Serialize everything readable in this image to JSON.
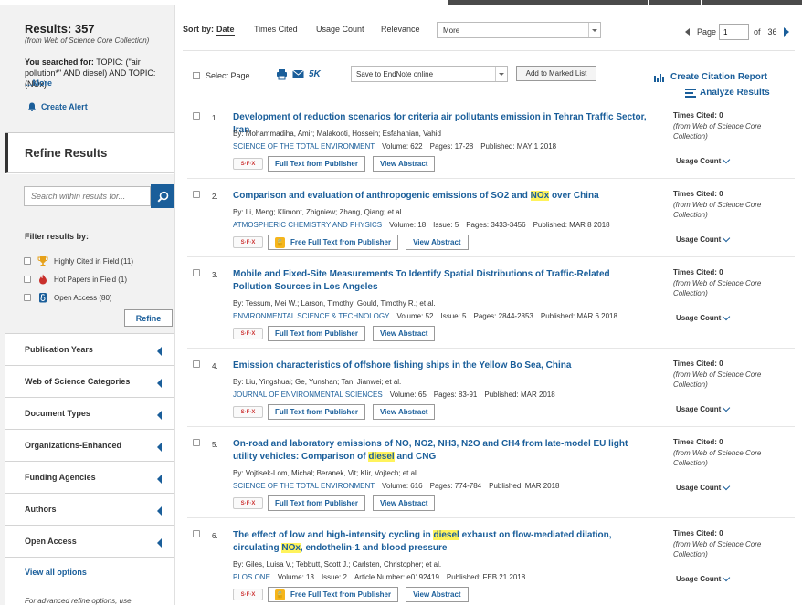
{
  "results": {
    "count_label": "Results: 357",
    "source": "(from Web of Science Core Collection)"
  },
  "search": {
    "label": "You searched for:",
    "query": "TOPIC: (\"air pollution*\" AND diesel) AND TOPIC: (NOx)",
    "more": "...More"
  },
  "alert": {
    "label": "Create Alert"
  },
  "refine": {
    "title": "Refine Results",
    "search_placeholder": "Search within results for...",
    "filter_title": "Filter results by:",
    "filters": [
      {
        "label": "Highly Cited in Field (11)",
        "icon": "trophy-icon"
      },
      {
        "label": "Hot Papers in Field (1)",
        "icon": "flame-icon"
      },
      {
        "label": "Open Access (80)",
        "icon": "open-access-icon"
      }
    ],
    "refine_button": "Refine",
    "categories": [
      "Publication Years",
      "Web of Science Categories",
      "Document Types",
      "Organizations-Enhanced",
      "Funding Agencies",
      "Authors",
      "Open Access"
    ],
    "view_all": "View all options",
    "advanced_note": "For advanced refine options, use"
  },
  "sort": {
    "label": "Sort by:",
    "options": [
      "Date",
      "Times Cited",
      "Usage Count",
      "Relevance"
    ],
    "more_value": "More"
  },
  "pager": {
    "label": "Page",
    "current": "1",
    "of_label": "of",
    "total": "36"
  },
  "toolbar": {
    "select_page": "Select Page",
    "five_k": "5K",
    "save_value": "Save to EndNote online",
    "add_marked": "Add to Marked List",
    "citation_report": "Create Citation Report",
    "analyze": "Analyze Results"
  },
  "labels": {
    "times_cited": "Times Cited: 0",
    "cited_source": "(from Web of Science Core Collection)",
    "usage_count": "Usage Count",
    "full_text": "Full Text from Publisher",
    "free_full_text": "Free Full Text from Publisher",
    "view_abstract": "View Abstract",
    "sfx": "S·F·X"
  },
  "records": [
    {
      "num": "1.",
      "title": "Development of reduction scenarios for criteria air pollutants emission in Tehran Traffic Sector, Iran",
      "authors": "By: Mohammadiha, Amir; Malakooti, Hossein; Esfahanian, Vahid",
      "journal": "SCIENCE OF THE TOTAL ENVIRONMENT",
      "volume": "Volume: 622",
      "issue": "",
      "pages": "Pages: 17-28",
      "published": "Published: MAY 1 2018",
      "free": false
    },
    {
      "num": "2.",
      "title_parts": [
        "Comparison and evaluation of anthropogenic emissions of SO2 and ",
        "NOx",
        " over China"
      ],
      "authors": "By: Li, Meng; Klimont, Zbigniew; Zhang, Qiang; et al.",
      "journal": "ATMOSPHERIC CHEMISTRY AND PHYSICS",
      "volume": "Volume: 18",
      "issue": "Issue: 5",
      "pages": "Pages: 3433-3456",
      "published": "Published: MAR 8 2018",
      "free": true
    },
    {
      "num": "3.",
      "title": "Mobile and Fixed-Site Measurements To Identify Spatial Distributions of Traffic-Related Pollution Sources in Los Angeles",
      "authors": "By: Tessum, Mei W.; Larson, Timothy; Gould, Timothy R.; et al.",
      "journal": "ENVIRONMENTAL SCIENCE & TECHNOLOGY",
      "volume": "Volume: 52",
      "issue": "Issue: 5",
      "pages": "Pages: 2844-2853",
      "published": "Published: MAR 6 2018",
      "free": false
    },
    {
      "num": "4.",
      "title": "Emission characteristics of offshore fishing ships in the Yellow Bo Sea, China",
      "authors": "By: Liu, Yingshuai; Ge, Yunshan; Tan, Jianwei; et al.",
      "journal": "JOURNAL OF ENVIRONMENTAL SCIENCES",
      "volume": "Volume: 65",
      "issue": "",
      "pages": "Pages: 83-91",
      "published": "Published: MAR 2018",
      "free": false
    },
    {
      "num": "5.",
      "title_parts": [
        "On-road and laboratory emissions of NO, NO2, NH3, N2O and CH4 from late-model EU light utility vehicles: Comparison of ",
        "diesel",
        " and CNG"
      ],
      "authors": "By: Vojtisek-Lom, Michal; Beranek, Vit; Klir, Vojtech; et al.",
      "journal": "SCIENCE OF THE TOTAL ENVIRONMENT",
      "volume": "Volume: 616",
      "issue": "",
      "pages": "Pages: 774-784",
      "published": "Published: MAR 2018",
      "free": false
    },
    {
      "num": "6.",
      "title_parts": [
        "The effect of low and high-intensity cycling in ",
        "diesel",
        " exhaust on flow-mediated dilation, circulating ",
        "NOx",
        ", endothelin-1 and blood pressure"
      ],
      "authors": "By: Giles, Luisa V.; Tebbutt, Scott J.; Carlsten, Christopher; et al.",
      "journal": "PLOS ONE",
      "volume": "Volume: 13",
      "issue": "Issue: 2",
      "pages": "Article Number: e0192419",
      "published": "Published: FEB 21 2018",
      "free": true
    }
  ],
  "colors": {
    "link": "#1a5e9a",
    "highlight": "#fff35c",
    "panel": "#f2f2f2"
  }
}
